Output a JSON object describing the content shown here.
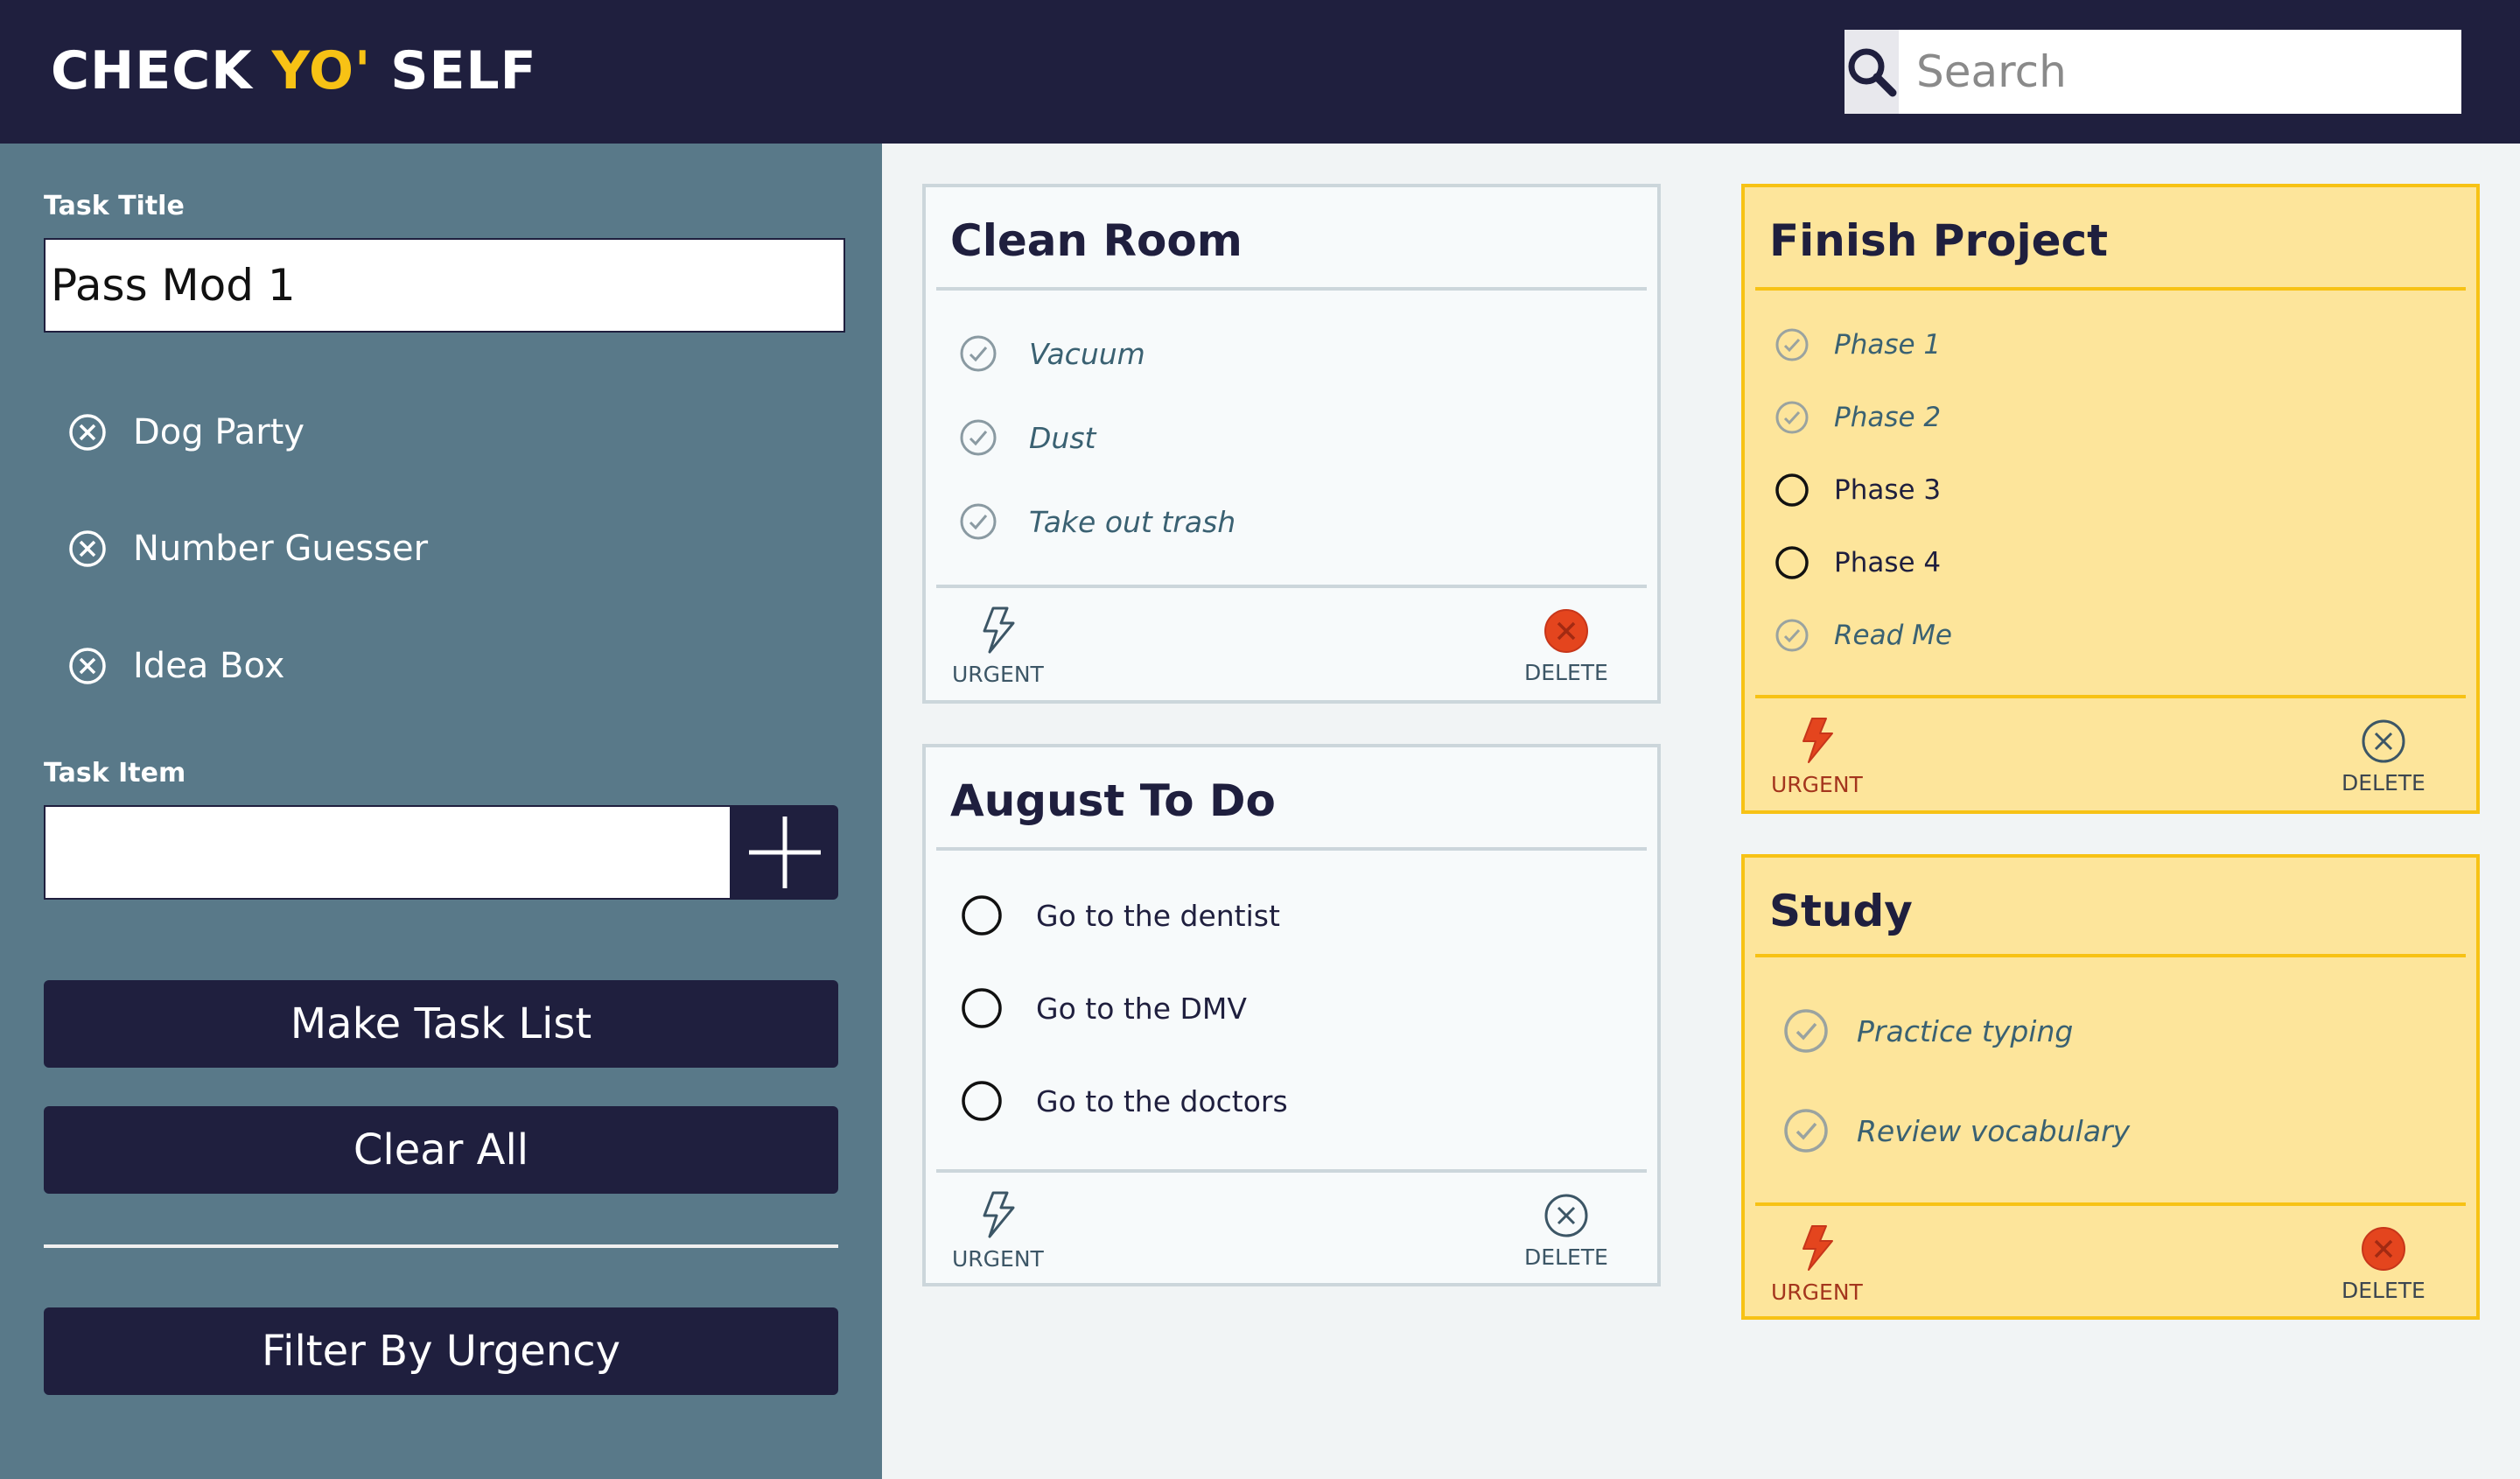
{
  "header": {
    "logo_part1": "CHECK ",
    "logo_part2": "YO'",
    "logo_part3": " SELF",
    "search_placeholder": "Search"
  },
  "sidebar": {
    "task_title_label": "Task Title",
    "task_title_value": "Pass Mod 1",
    "draft_items": [
      "Dog Party",
      "Number Guesser",
      "Idea Box"
    ],
    "task_item_label": "Task Item",
    "task_item_value": "",
    "make_task_list": "Make Task List",
    "clear_all": "Clear All",
    "filter_by_urgency": "Filter By Urgency"
  },
  "cards": [
    {
      "title": "Clean Room",
      "urgent": false,
      "tasks": [
        {
          "text": "Vacuum",
          "done": true
        },
        {
          "text": "Dust",
          "done": true
        },
        {
          "text": "Take out trash",
          "done": true
        }
      ],
      "urgent_label": "URGENT",
      "delete_label": "DELETE",
      "delete_active": true
    },
    {
      "title": "August To Do",
      "urgent": false,
      "tasks": [
        {
          "text": "Go to the dentist",
          "done": false
        },
        {
          "text": "Go to the DMV",
          "done": false
        },
        {
          "text": "Go to the doctors",
          "done": false
        }
      ],
      "urgent_label": "URGENT",
      "delete_label": "DELETE",
      "delete_active": false
    },
    {
      "title": "Finish Project",
      "urgent": true,
      "tasks": [
        {
          "text": "Phase 1",
          "done": true
        },
        {
          "text": "Phase 2",
          "done": true
        },
        {
          "text": "Phase 3",
          "done": false
        },
        {
          "text": "Phase 4",
          "done": false
        },
        {
          "text": "Read Me",
          "done": true
        }
      ],
      "urgent_label": "URGENT",
      "delete_label": "DELETE",
      "delete_active": false
    },
    {
      "title": "Study",
      "urgent": true,
      "tasks": [
        {
          "text": "Practice typing",
          "done": true
        },
        {
          "text": "Review vocabulary",
          "done": true
        }
      ],
      "urgent_label": "URGENT",
      "delete_label": "DELETE",
      "delete_active": true
    }
  ],
  "colors": {
    "navy": "#1f1f3e",
    "sidebar": "#597989",
    "accent_yellow": "#f7c215",
    "urgent_card_bg": "#fde59b",
    "delete_active": "#e4451e",
    "urgent_bolt": "#e4451e"
  }
}
